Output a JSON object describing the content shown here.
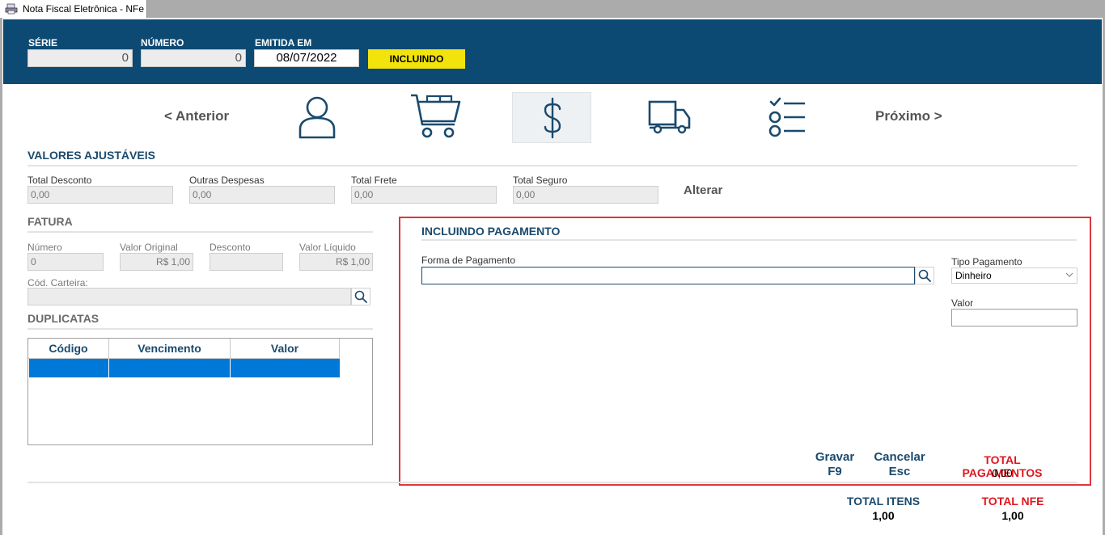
{
  "window": {
    "tab_title": "Nota Fiscal Eletrônica - NFe"
  },
  "header": {
    "serie_label": "SÉRIE",
    "serie_value": "0",
    "numero_label": "NÚMERO",
    "numero_value": "0",
    "emitida_label": "EMITIDA EM",
    "emitida_value": "08/07/2022",
    "status": "INCLUINDO",
    "band_color": "#0d4a73",
    "status_color": "#f2e30d"
  },
  "nav": {
    "prev_label": "< Anterior",
    "next_label": "Próximo >",
    "steps": [
      "person-icon",
      "cart-icon",
      "dollar-icon",
      "truck-icon",
      "checklist-icon"
    ],
    "active_step": "dollar-icon"
  },
  "valores": {
    "title": "VALORES AJUSTÁVEIS",
    "desconto_label": "Total Desconto",
    "desconto_value": "0,00",
    "despesas_label": "Outras Despesas",
    "despesas_value": "0,00",
    "frete_label": "Total Frete",
    "frete_value": "0,00",
    "seguro_label": "Total Seguro",
    "seguro_value": "0,00",
    "alterar_label": "Alterar"
  },
  "fatura": {
    "title": "FATURA",
    "numero_label": "Número",
    "numero_value": "0",
    "original_label": "Valor Original",
    "original_value": "R$ 1,00",
    "desconto_label": "Desconto",
    "desconto_value": "",
    "liquido_label": "Valor Líquido",
    "liquido_value": "R$ 1,00",
    "carteira_label": "Cód. Carteira:",
    "carteira_value": ""
  },
  "duplicatas": {
    "title": "DUPLICATAS",
    "columns": [
      "Código",
      "Vencimento",
      "Valor"
    ]
  },
  "pagamento": {
    "title": "INCLUINDO PAGAMENTO",
    "forma_label": "Forma de Pagamento",
    "forma_value": "",
    "tipo_label": "Tipo Pagamento",
    "tipo_value": "Dinheiro",
    "valor_label": "Valor",
    "valor_value": "",
    "gravar_label": "Gravar",
    "gravar_key": "F9",
    "cancelar_label": "Cancelar",
    "cancelar_key": "Esc",
    "total_label": "TOTAL PAGAMENTOS",
    "total_value": "0,00",
    "border_color": "#d9373f"
  },
  "totals": {
    "itens_label": "TOTAL ITENS",
    "itens_value": "1,00",
    "nfe_label": "TOTAL NFE",
    "nfe_value": "1,00"
  }
}
